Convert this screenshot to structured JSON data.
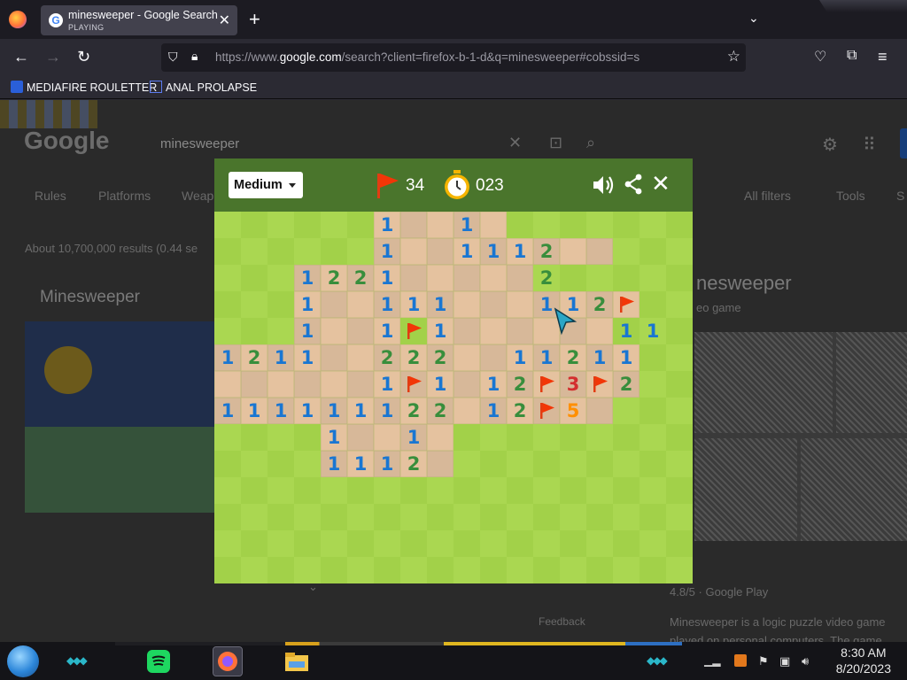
{
  "browser": {
    "tab": {
      "title": "minesweeper - Google Search",
      "subtitle": "PLAYING"
    },
    "url": {
      "host_part": "google.com",
      "prefix": "https://www.",
      "suffix": "/search?client=firefox-b-1-d&q=minesweeper#cobssid=s"
    },
    "bookmarks": [
      {
        "label": "MEDIAFIRE ROULETTER",
        "icon": "mediafire-icon"
      },
      {
        "label": "ANAL PROLAPSE",
        "icon": "bookmark-sigma-icon"
      }
    ]
  },
  "page": {
    "logo": "Google",
    "search_query": "minesweeper",
    "nav": [
      "Rules",
      "Platforms",
      "Weap"
    ],
    "results_count": "About 10,700,000 results (0.44 se",
    "left_card_title": "Minesweeper",
    "right_title": "nesweeper",
    "right_sub": "eo game",
    "filters": [
      "All filters",
      "Tools",
      "S"
    ],
    "rating": "4.8/5 · Google Play",
    "desc1": "Minesweeper is a logic puzzle video game",
    "desc2": "played on personal computers. The game",
    "feedback": "Feedback"
  },
  "game": {
    "difficulty": "Medium",
    "flags_left": "34",
    "timer": "023",
    "colors": {
      "header": "#4a752c",
      "grass_light": "#aad751",
      "grass_dark": "#a2d149",
      "open_light": "#e5c29f",
      "open_dark": "#d7b899"
    },
    "number_colors": {
      "1": "#1976d2",
      "2": "#388e3c",
      "3": "#d32f2f",
      "5": "#ff8f00"
    },
    "cols": 18,
    "rows": 14,
    "board": [
      "......1..1........",
      "......1..1112.....",
      "...1221.....2.....",
      "...1..111...112F..",
      "...1..1F1......11.",
      "1211..222..11211..",
      "......1F1.12F3F2..",
      "111111122.12F5....",
      "....1..1..........",
      "....1112..........",
      "..................",
      "..................",
      "..................",
      ".................."
    ],
    "opened_mask": [
      "......#####.......",
      "......#########...",
      "...#########......",
      "...#############F.",
      "...####F#######...",
      "################..",
      "################..",
      "###############...",
      "....#####.........",
      "....#####.........",
      "..................",
      "..................",
      "..................",
      ".................."
    ]
  },
  "taskbar": {
    "time": "8:30 AM",
    "date": "8/20/2023",
    "apps": [
      "start-orb-icon",
      "spotify-icon",
      "firefox-icon",
      "file-explorer-icon"
    ]
  }
}
